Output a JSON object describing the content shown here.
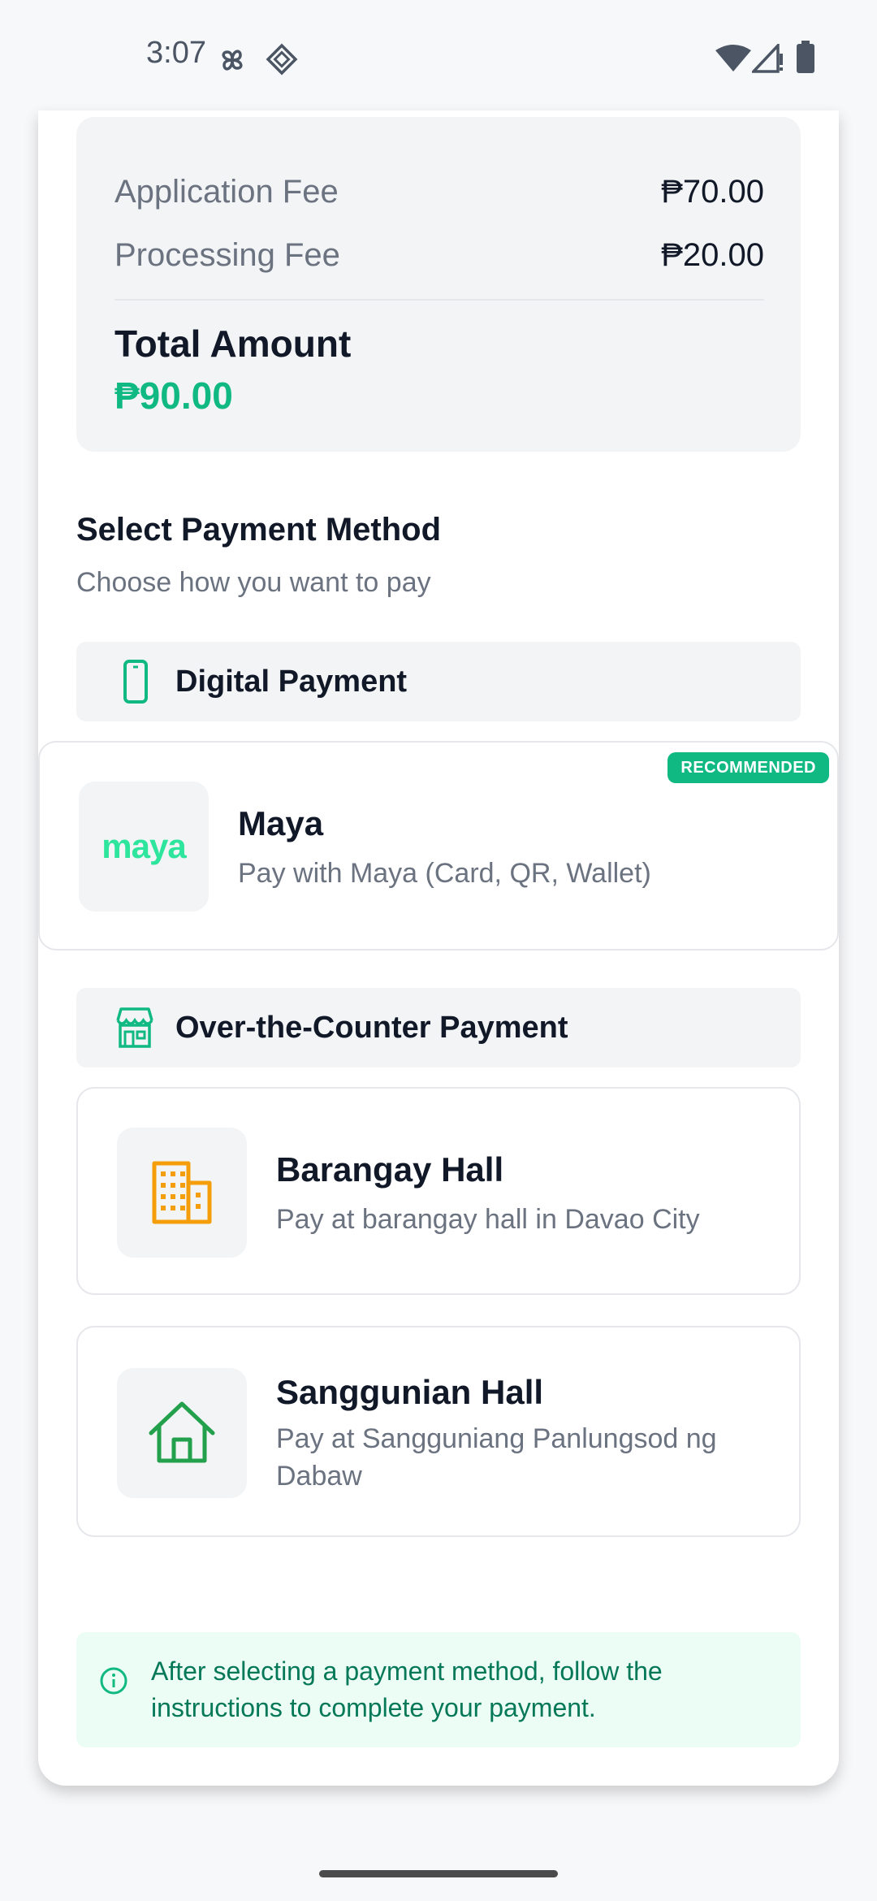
{
  "status_bar": {
    "time": "3:07",
    "icons": [
      "pinwheel-icon",
      "diamond-grid-icon",
      "wifi-icon",
      "signal-icon",
      "battery-icon"
    ]
  },
  "fees": {
    "application_fee_label": "Application Fee",
    "application_fee_value": "₱70.00",
    "processing_fee_label": "Processing Fee",
    "processing_fee_value": "₱20.00",
    "total_label": "Total Amount",
    "total_value": "₱90.00"
  },
  "payment": {
    "title": "Select Payment Method",
    "subtitle": "Choose how you want to pay",
    "digital_header": "Digital Payment",
    "maya": {
      "logo_text": "maya",
      "title": "Maya",
      "description": "Pay with Maya (Card, QR, Wallet)",
      "badge": "RECOMMENDED"
    },
    "otc_header": "Over-the-Counter Payment",
    "barangay": {
      "title": "Barangay Hall",
      "description": "Pay at barangay hall in Davao City"
    },
    "sanggunian": {
      "title": "Sanggunian Hall",
      "description": "Pay at Sangguniang Panlungsod ng Dabaw"
    }
  },
  "info": {
    "text": "After selecting a payment method, follow the instructions to complete your payment."
  },
  "colors": {
    "accent_green": "#10b981",
    "barangay_icon": "#f59e0b",
    "sanggunian_icon": "#22a04b",
    "maya_brand": "#2ee59d"
  }
}
